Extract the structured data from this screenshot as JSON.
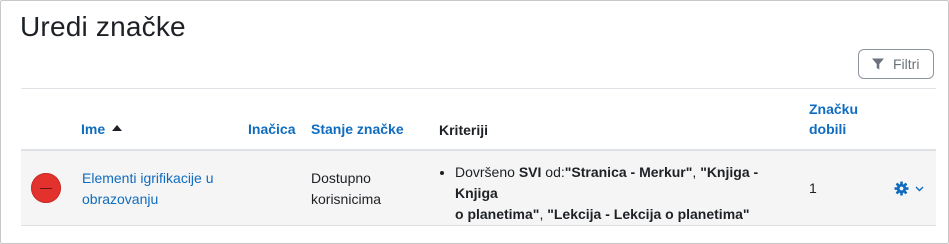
{
  "page": {
    "title": "Uredi značke"
  },
  "filter_button": {
    "label": "Filtri",
    "icon": "filter-icon"
  },
  "table": {
    "headers": {
      "name": "Ime",
      "version": "Inačica",
      "status": "Stanje značke",
      "criteria": "Kriteriji",
      "recipients_line1": "Značku",
      "recipients_line2": "dobili"
    },
    "sort": {
      "column": "name",
      "direction": "ascending",
      "icon": "sort-ascending-icon"
    },
    "rows": [
      {
        "badge_image": {
          "color": "#e3312d"
        },
        "name_line1": "Elementi igrifikacije u",
        "name_line2": "obrazovanju",
        "version": "",
        "status_line1": "Dostupno",
        "status_line2": "korisnicima",
        "criteria": {
          "prefix": "Dovršeno ",
          "scope": "SVI",
          "connector": " od:",
          "item1": "\"Stranica - Merkur\"",
          "sep1": ", ",
          "item2a": "\"Knjiga - Knjiga",
          "item2b": "o planetima\"",
          "sep2": ", ",
          "item3": "\"Lekcija - Lekcija o planetima\""
        },
        "recipients": "1",
        "actions_icon": "gear-icon",
        "actions_caret": "chevron-down-icon"
      }
    ]
  },
  "colors": {
    "link": "#0f6cbf",
    "text": "#1d2125",
    "row_bg": "#f5f5f5"
  }
}
